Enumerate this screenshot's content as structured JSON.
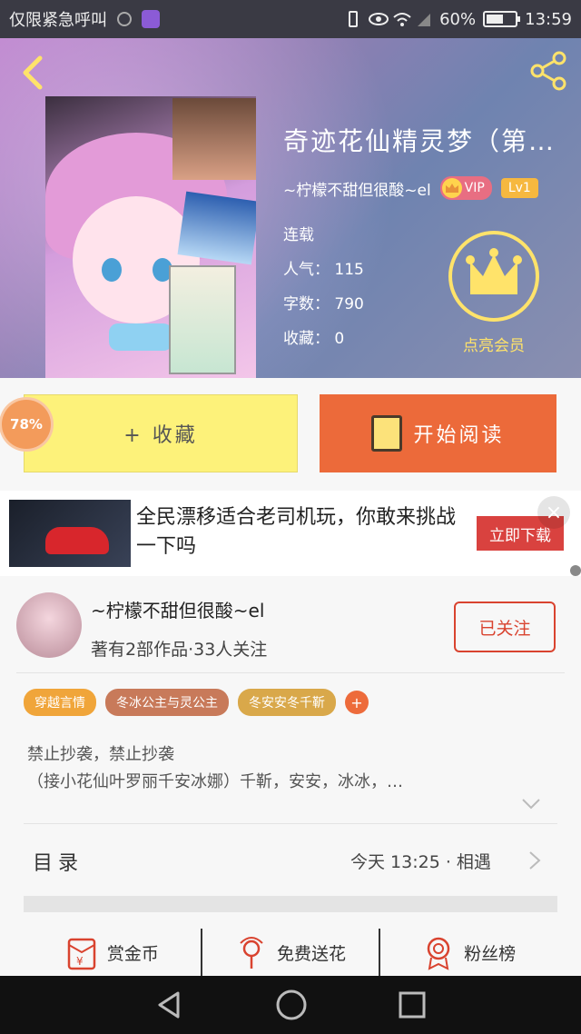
{
  "status_bar": {
    "carrier": "仅限紧急呼叫",
    "battery": "60%",
    "battery_level": 0.6,
    "time": "13:59"
  },
  "book": {
    "title": "奇迹花仙精灵梦（第…",
    "author": "~柠檬不甜但很酸~el",
    "vip_label": "VIP",
    "level_label": "Lv1",
    "status": "连载",
    "popularity": "人气：  115",
    "word_count": "字数：  790",
    "favorites": "收藏：  0",
    "crown_label": "点亮会员"
  },
  "actions": {
    "progress": "78%",
    "collect_label": "+ 收藏",
    "read_label": "开始阅读"
  },
  "ad": {
    "text": "全民漂移适合老司机玩，你敢来挑战一下吗",
    "button_label": "立即下载",
    "close": "×"
  },
  "author_card": {
    "name": "~柠檬不甜但很酸~el",
    "stats": "著有2部作品·33人关注",
    "follow_label": "已关注",
    "tags": [
      {
        "label": "穿越言情",
        "color": "#f0a53a"
      },
      {
        "label": "冬冰公主与灵公主",
        "color": "#c87a5a"
      },
      {
        "label": "冬安安冬千靳",
        "color": "#d9a84a"
      }
    ],
    "tag_add": "+",
    "intro_line1": "禁止抄袭，禁止抄袭",
    "intro_line2": "（接小花仙叶罗丽千安冰娜）千靳，安安，冰冰，…",
    "toc_label": "目录",
    "toc_latest": "今天 13:25 · 相遇"
  },
  "bottom_actions": [
    {
      "label": "赏金币",
      "icon": "red-envelope-icon"
    },
    {
      "label": "免费送花",
      "icon": "flower-icon"
    },
    {
      "label": "粉丝榜",
      "icon": "medal-icon"
    }
  ],
  "colors": {
    "accent_orange": "#ec6a3a",
    "collect_yellow": "#fdf27a",
    "follow_red": "#d9432f"
  }
}
